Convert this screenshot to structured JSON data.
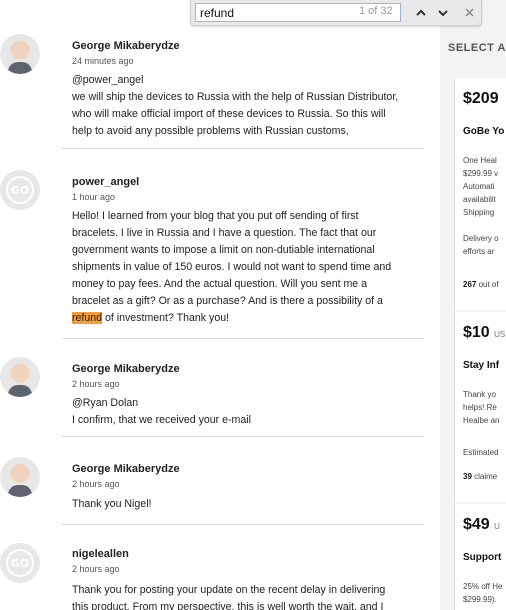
{
  "find": {
    "query": "refund",
    "count": "1 of 32",
    "prev_icon": "chevron-up-icon",
    "next_icon": "chevron-down-icon",
    "close_icon": "close-icon"
  },
  "comments": [
    {
      "avatar": "photo",
      "author": "George Mikaberydze",
      "time": "24 minutes ago",
      "lines": [
        "@power_angel",
        "we will ship the devices to Russia with the help of Russian Distributor,",
        "who will make official import of these devices to Russia. So this will",
        "help to avoid any possible problems with Russian customs,"
      ]
    },
    {
      "avatar": "go",
      "avatar_text": "GO",
      "author": "power_angel",
      "time": "1 hour ago",
      "lines": [
        "Hello! I learned from your blog that you put off sending of first",
        "bracelets. I live in Russia and I have a question. The fact that our",
        "government wants to impose a limit on non-dutiable international",
        "shipments in value of 150 euros. I would not want to spend time and",
        "money to pay fees. And the actual question. Will you sent me a",
        "bracelet as a gift? Or as a purchase? And is there a possibility of a"
      ],
      "highlight_word": "refund",
      "last_line_rest": " of investment? Thank you!"
    },
    {
      "avatar": "photo",
      "author": "George Mikaberydze",
      "time": "2 hours ago",
      "lines": [
        "@Ryan Dolan",
        "I confirm, that we received your e-mail"
      ]
    },
    {
      "avatar": "photo",
      "author": "George Mikaberydze",
      "time": "2 hours ago",
      "lines": [
        "Thank you Nigel!"
      ]
    },
    {
      "avatar": "go",
      "avatar_text": "GO",
      "author": "nigeleallen",
      "time": "2 hours ago",
      "lines": [
        "Thank you for posting your update on the recent delay in delivering",
        "this product. From my perspective, this is well worth the wait, and I"
      ]
    }
  ],
  "sidebar": {
    "title": "SELECT A",
    "cards": [
      {
        "price": "$209",
        "currency": "",
        "title": "GoBe Yo",
        "lines": [
          "One Heal",
          "$299.99 v",
          "Automati",
          "availabilit",
          "Shipping"
        ],
        "lines2": [
          "Delivery o",
          "efforts ar"
        ],
        "claimed_num": "267",
        "claimed_text": " out of"
      },
      {
        "price": "$10",
        "currency": "US",
        "title": "Stay Inf",
        "lines": [
          "Thank yo",
          "helps! Re",
          "Healbe an"
        ],
        "lines2": [
          "Estimated"
        ],
        "claimed_num": "39",
        "claimed_text": " claime"
      },
      {
        "price": "$49",
        "currency": "U",
        "title": "Support",
        "lines": [
          "25% off He",
          "$299.99)."
        ],
        "lines2": [],
        "claimed_num": "",
        "claimed_text": ""
      }
    ]
  },
  "colors": {
    "highlight": "#f29d3a",
    "divider": "#dddddd",
    "sidebar_bg": "#f3f3f3"
  }
}
